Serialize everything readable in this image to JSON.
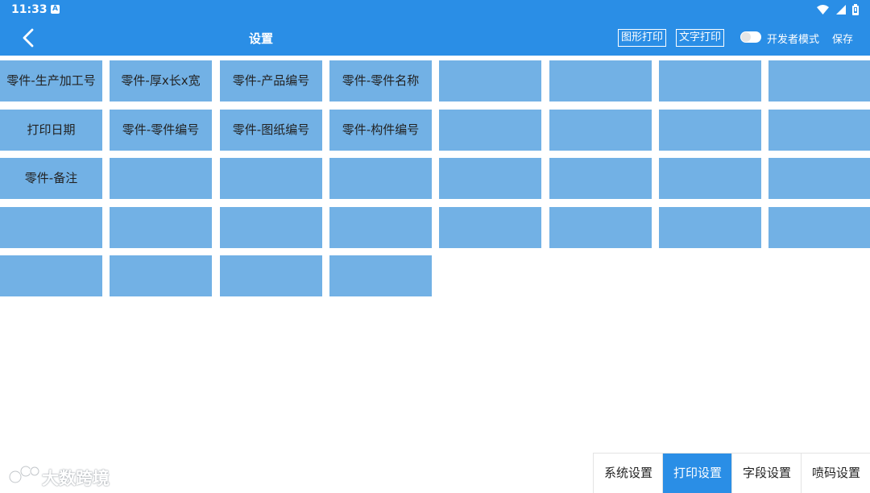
{
  "status_bar": {
    "time": "11:33",
    "notification_icon": "a-icon",
    "icons": [
      "wifi-icon",
      "signal-icon",
      "battery-icon"
    ]
  },
  "app_bar": {
    "title": "设置",
    "back_icon": "chevron-left-icon",
    "graphic_print": "图形打印",
    "text_print": "文字打印",
    "developer_mode": "开发者模式",
    "developer_mode_on": false,
    "save": "保存"
  },
  "grid": {
    "columns": 8,
    "cells": [
      "零件-生产加工号",
      "零件-厚x长x宽",
      "零件-产品编号",
      "零件-零件名称",
      "",
      "",
      "",
      "",
      "打印日期",
      "零件-零件编号",
      "零件-图纸编号",
      "零件-构件编号",
      "",
      "",
      "",
      "",
      "零件-备注",
      "",
      "",
      "",
      "",
      "",
      "",
      "",
      "",
      "",
      "",
      "",
      "",
      "",
      "",
      "",
      "",
      "",
      "",
      ""
    ]
  },
  "tabs": [
    {
      "label": "系统设置",
      "active": false
    },
    {
      "label": "打印设置",
      "active": true
    },
    {
      "label": "字段设置",
      "active": false
    },
    {
      "label": "喷码设置",
      "active": false
    }
  ],
  "watermark": {
    "text": "大数跨境"
  },
  "colors": {
    "primary": "#2a8ee6",
    "cell": "#72b1e5",
    "text": "#222222"
  }
}
